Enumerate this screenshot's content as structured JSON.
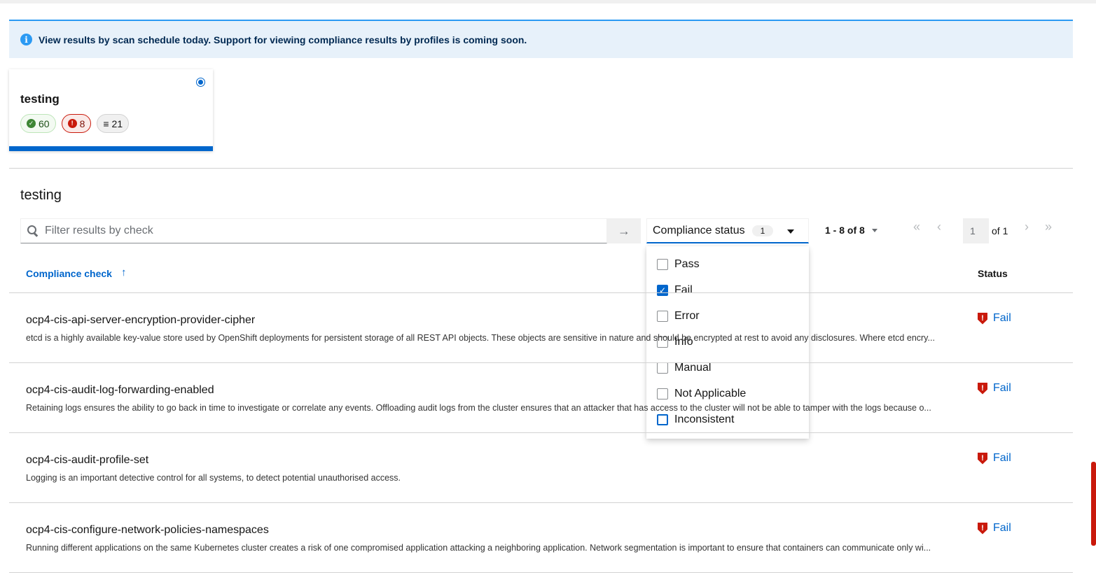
{
  "alert": {
    "text": "View results by scan schedule today. Support for viewing compliance results by profiles is coming soon."
  },
  "scan_card": {
    "title": "testing",
    "pass_count": "60",
    "fail_count": "8",
    "other_count": "21"
  },
  "section_title": "testing",
  "search": {
    "placeholder": "Filter results by check"
  },
  "filter": {
    "label": "Compliance status",
    "selected_count": "1",
    "options": [
      {
        "label": "Pass",
        "checked": false
      },
      {
        "label": "Fail",
        "checked": true
      },
      {
        "label": "Error",
        "checked": false
      },
      {
        "label": "Info",
        "checked": false
      },
      {
        "label": "Manual",
        "checked": false
      },
      {
        "label": "Not Applicable",
        "checked": false
      },
      {
        "label": "Inconsistent",
        "checked": false
      }
    ]
  },
  "pagination": {
    "range": "1 - 8 of 8",
    "page": "1",
    "of_text": "of 1"
  },
  "table": {
    "columns": {
      "check": "Compliance check",
      "status": "Status"
    },
    "rows": [
      {
        "name": "ocp4-cis-api-server-encryption-provider-cipher",
        "description": "etcd is a highly available key-value store used by OpenShift deployments for persistent storage of all REST API objects. These objects are sensitive in nature and should be encrypted at rest to avoid any disclosures. Where etcd encry...",
        "status": "Fail"
      },
      {
        "name": "ocp4-cis-audit-log-forwarding-enabled",
        "description": "Retaining logs ensures the ability to go back in time to investigate or correlate any events. Offloading audit logs from the cluster ensures that an attacker that has access to the cluster will not be able to tamper with the logs because o...",
        "status": "Fail"
      },
      {
        "name": "ocp4-cis-audit-profile-set",
        "description": "Logging is an important detective control for all systems, to detect potential unauthorised access.",
        "status": "Fail"
      },
      {
        "name": "ocp4-cis-configure-network-policies-namespaces",
        "description": "Running different applications on the same Kubernetes cluster creates a risk of one compromised application attacking a neighboring application. Network segmentation is important to ensure that containers can communicate only wi...",
        "status": "Fail"
      }
    ]
  },
  "icons": {
    "alert": "info-circle-icon",
    "pass": "check-circle-icon",
    "fail": "exclamation-circle-icon",
    "other": "list-icon",
    "status_fail": "shield-exclamation-icon"
  },
  "colors": {
    "primary": "#0066cc",
    "danger": "#c9190b",
    "success": "#3e8635",
    "info_bg": "#e7f1fa"
  }
}
